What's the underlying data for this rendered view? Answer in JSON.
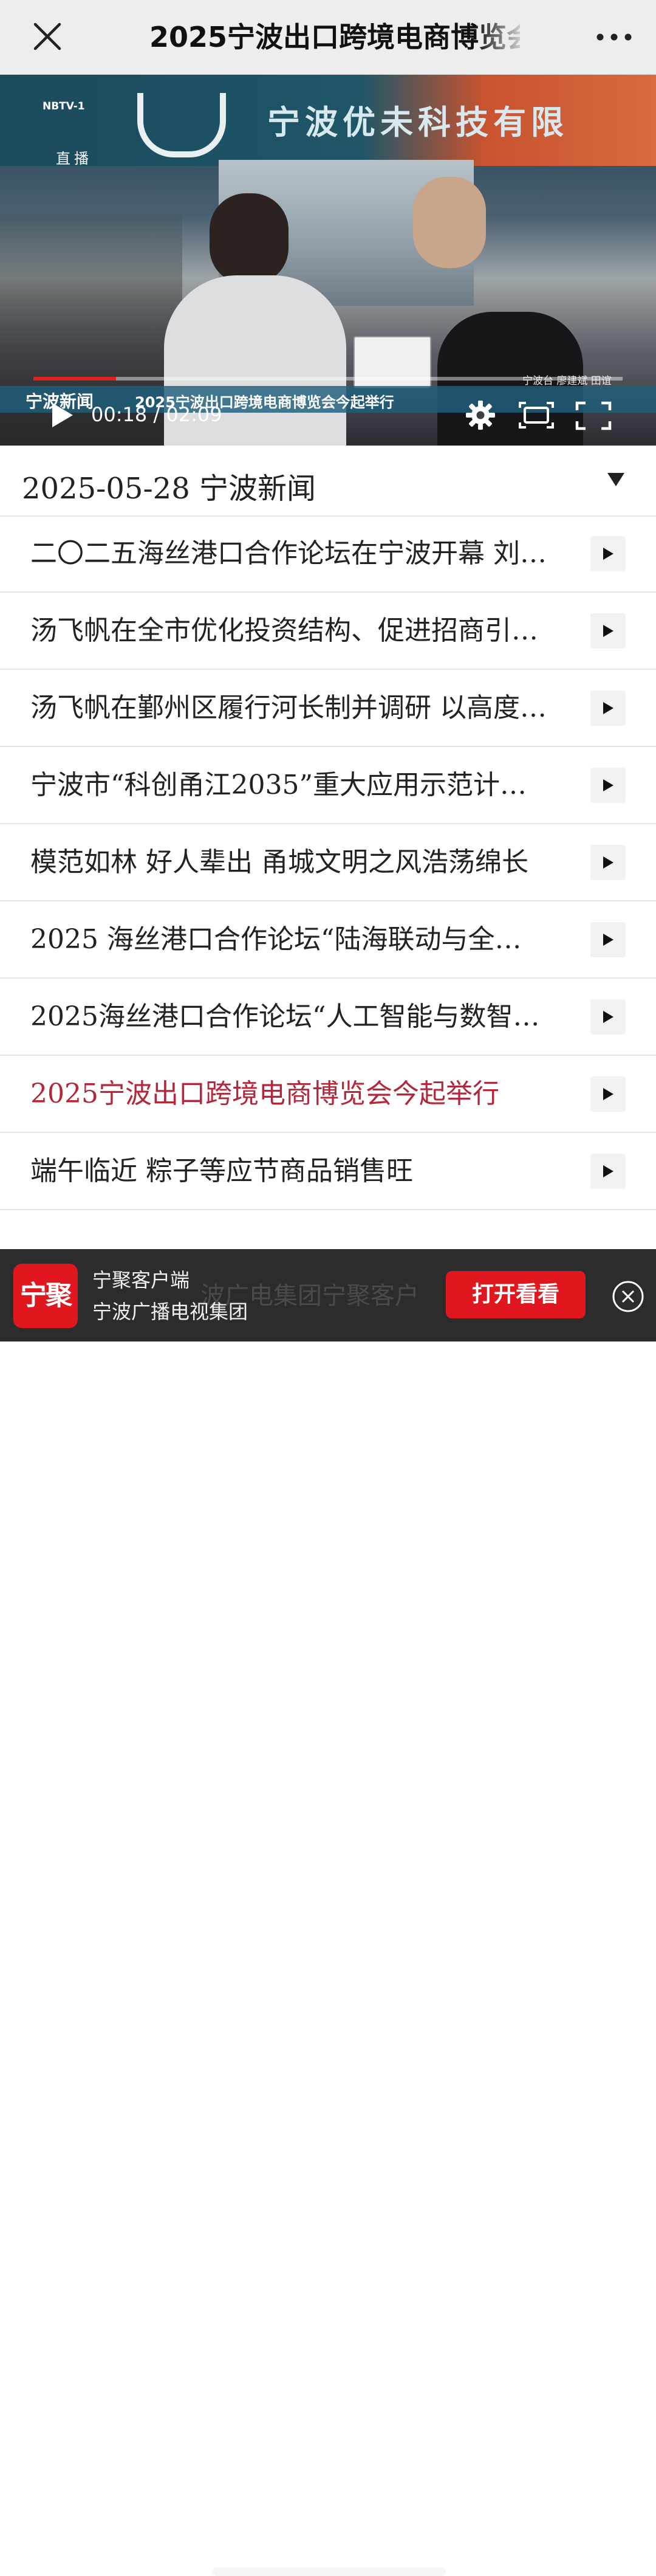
{
  "header": {
    "title": "2025宁波出口跨境电商博览会",
    "close_icon": "close-icon",
    "more_icon": "more-icon"
  },
  "video": {
    "watermark_channel": "NBTV-1",
    "watermark_live": "直播",
    "booth_sign": "宁波优未科技有限",
    "chyron_brand": "宁波新闻",
    "chyron_text": "2025宁波出口跨境电商博览会今起举行",
    "credits": "宁波台 廖建斌 田谊",
    "current_time": "00:18",
    "duration": "02:09",
    "time_display": "00:18 / 02:09",
    "progress": 0.14,
    "accent_color": "#e0221f"
  },
  "section": {
    "date_label": "2025-05-28 宁波新闻"
  },
  "news": [
    {
      "title": "二〇二五海丝港口合作论坛在宁波开幕 刘…",
      "active": false
    },
    {
      "title": "汤飞帆在全市优化投资结构、促进招商引…",
      "active": false
    },
    {
      "title": "汤飞帆在鄞州区履行河长制并调研 以高度…",
      "active": false
    },
    {
      "title": "宁波市“科创甬江2035”重大应用示范计…",
      "active": false
    },
    {
      "title": "模范如林 好人辈出 甬城文明之风浩荡绵长",
      "active": false
    },
    {
      "title": "2025 海丝港口合作论坛“陆海联动与全…",
      "active": false
    },
    {
      "title": "2025海丝港口合作论坛“人工智能与数智…",
      "active": false
    },
    {
      "title": "2025宁波出口跨境电商博览会今起举行",
      "active": true
    },
    {
      "title": "端午临近 粽子等应节商品销售旺",
      "active": false
    }
  ],
  "banner": {
    "app_icon_text": "宁聚",
    "app_name": "宁聚客户端",
    "org_name": "宁波广播电视集团",
    "ghost_text": "波广电集团宁聚客户",
    "open_button": "打开看看"
  },
  "colors": {
    "active_item": "#b3273a",
    "brand_red": "#e1171f",
    "banner_bg": "#2c2c2c"
  }
}
